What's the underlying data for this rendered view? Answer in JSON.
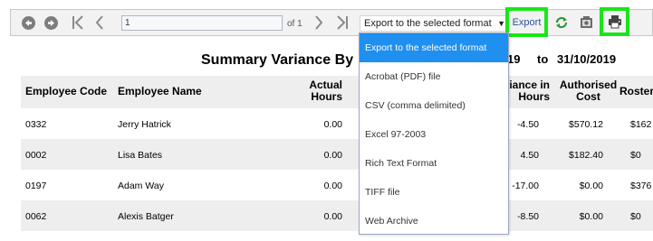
{
  "toolbar": {
    "page_value": "1",
    "of_text": "of 1",
    "format_selected": "Export to the selected format",
    "export_label": "Export",
    "icons": {
      "back": "circle-back-icon",
      "forward": "circle-forward-icon",
      "first": "first-page-icon",
      "prev": "previous-page-icon",
      "next": "next-page-icon",
      "last": "last-page-icon",
      "refresh": "refresh-icon",
      "preview": "print-preview-icon",
      "print": "printer-icon"
    },
    "highlight_color": "#19e619"
  },
  "report": {
    "title": "Summary Variance By",
    "date_from": "19",
    "to_label": "to",
    "date_to": "31/10/2019",
    "headers": {
      "employee_code": "Employee Code",
      "employee_name": "Employee Name",
      "actual_hours_1": "Actual",
      "actual_hours_2": "Hours",
      "variance_hours_1": "iance in",
      "variance_hours_2": "Hours",
      "authorised_cost_1": "Authorised",
      "authorised_cost_2": "Cost",
      "roster": "Roster"
    },
    "rows": [
      {
        "code": "0332",
        "name": "Jerry Hatrick",
        "actual": "0.00",
        "variance": "-4.50",
        "cost": "$570.12",
        "roster": "$162"
      },
      {
        "code": "0002",
        "name": "Lisa Bates",
        "actual": "0.00",
        "variance": "4.50",
        "cost": "$182.40",
        "roster": "$0"
      },
      {
        "code": "0197",
        "name": "Adam Way",
        "actual": "0.00",
        "variance": "-17.00",
        "cost": "$0.00",
        "roster": "$376"
      },
      {
        "code": "0062",
        "name": "Alexis Batger",
        "actual": "0.00",
        "variance": "-8.50",
        "cost": "$0.00",
        "roster": "$0"
      }
    ]
  },
  "dropdown": {
    "options": [
      "Export to the selected format",
      "Acrobat (PDF) file",
      "CSV (comma delimited)",
      "Excel 97-2003",
      "Rich Text Format",
      "TIFF file",
      "Web Archive"
    ],
    "selected_index": 0,
    "selected_color": "#1f8ff0"
  }
}
